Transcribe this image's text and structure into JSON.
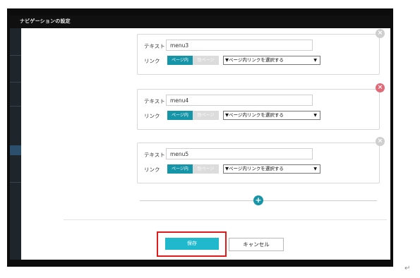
{
  "dialog": {
    "title": "ナビゲーションの設定"
  },
  "labels": {
    "text": "テキスト",
    "link": "リンク"
  },
  "toggle": {
    "in_page": "ページ内",
    "other_page": "別ページ"
  },
  "select_placeholder": "▼ページ内リンクを選択する",
  "menus": [
    {
      "text_value": "menu3"
    },
    {
      "text_value": "menu4"
    },
    {
      "text_value": "menu5"
    }
  ],
  "icons": {
    "close": "close-icon",
    "add": "plus-icon"
  },
  "buttons": {
    "save": "保存",
    "cancel": "キャンセル"
  },
  "colors": {
    "accent": "#1795a8",
    "save": "#20b8cc",
    "highlight": "#e21a1a",
    "delete": "#e06a78"
  },
  "glyphs": {
    "close": "×",
    "add": "+",
    "caret": "▼",
    "return_mark": "↵"
  }
}
